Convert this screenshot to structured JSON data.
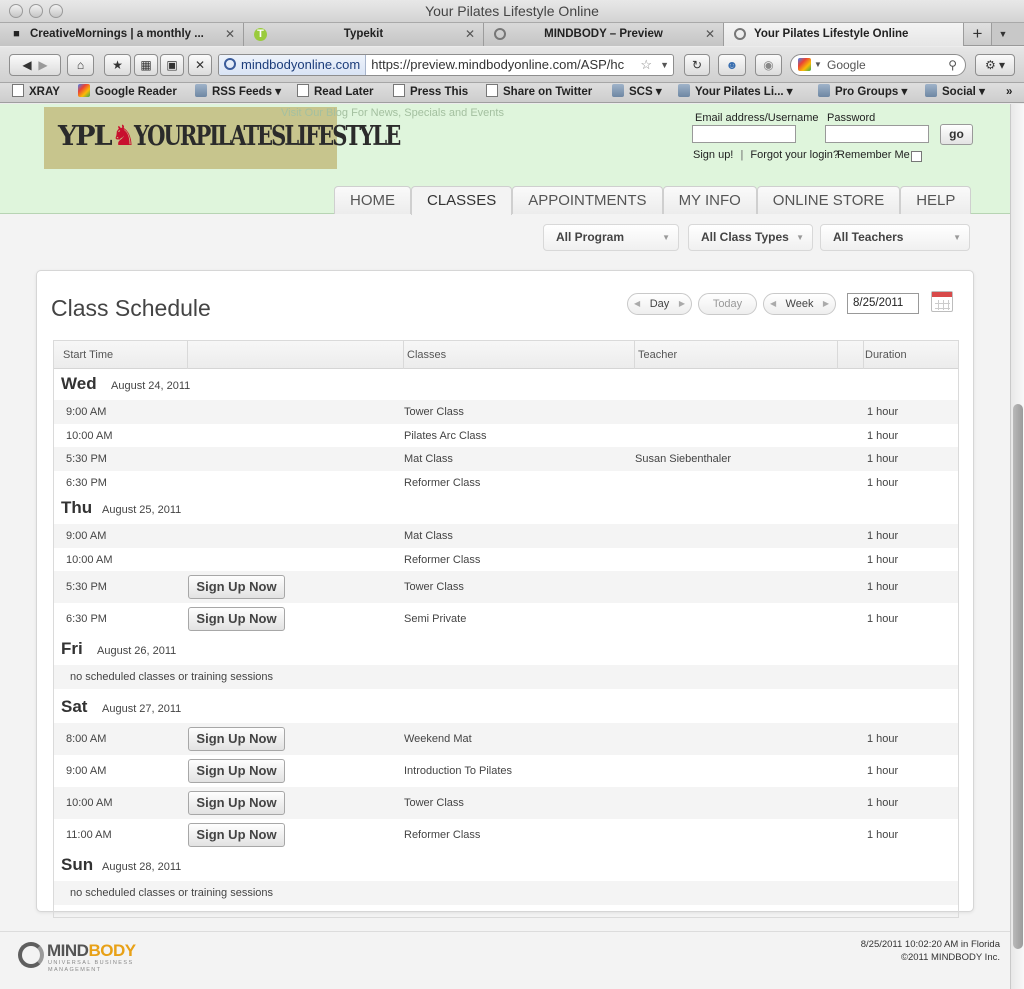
{
  "window": {
    "title": "Your Pilates Lifestyle Online"
  },
  "tabs": [
    {
      "label": "CreativeMornings | a monthly ...",
      "icon": "speech-bubble-icon"
    },
    {
      "label": "Typekit",
      "icon": "typekit-icon"
    },
    {
      "label": "MINDBODY – Preview",
      "icon": "loading-icon"
    },
    {
      "label": "Your Pilates Lifestyle Online",
      "icon": "loading-icon"
    }
  ],
  "toolbar": {
    "url_site": "mindbodyonline.com",
    "url_path": "https://preview.mindbodyonline.com/ASP/hc",
    "search_placeholder": "Google"
  },
  "bookmarks": [
    {
      "label": "XRAY",
      "icon": "page"
    },
    {
      "label": "Google Reader",
      "icon": "goog"
    },
    {
      "label": "RSS Feeds ▾",
      "icon": "folder"
    },
    {
      "label": "Read Later",
      "icon": "page"
    },
    {
      "label": "Press This",
      "icon": "page"
    },
    {
      "label": "Share on Twitter",
      "icon": "page"
    },
    {
      "label": "SCS ▾",
      "icon": "folder"
    },
    {
      "label": "Your Pilates Li... ▾",
      "icon": "folder"
    },
    {
      "label": "Pro Groups ▾",
      "icon": "folder"
    },
    {
      "label": "Social ▾",
      "icon": "folder"
    }
  ],
  "site": {
    "logo_ypl": "YPL",
    "logo_name": "YOURPILATESLIFESTYLE",
    "tagline": "Visit Our Blog For News, Specials and Events",
    "login": {
      "email_label": "Email address/Username",
      "password_label": "Password",
      "go_label": "go",
      "signup_link": "Sign up!",
      "divider": "|",
      "forgot_link": "Forgot your login?",
      "remember_label": "Remember Me"
    },
    "nav": [
      "HOME",
      "CLASSES",
      "APPOINTMENTS",
      "MY INFO",
      "ONLINE STORE",
      "HELP"
    ],
    "active_nav": "CLASSES",
    "filters": {
      "program": "All Program",
      "class_types": "All Class Types",
      "teachers": "All Teachers"
    }
  },
  "schedule": {
    "title": "Class Schedule",
    "nav": {
      "day": "Day",
      "today": "Today",
      "week": "Week",
      "date": "8/25/2011"
    },
    "columns": {
      "start_time": "Start Time",
      "classes": "Classes",
      "teacher": "Teacher",
      "duration": "Duration"
    },
    "signup_label": "Sign Up Now",
    "days": [
      {
        "name": "Wed",
        "date": "August 24, 2011",
        "rows": [
          {
            "time": "9:00 AM",
            "class": "Tower Class",
            "teacher": "",
            "duration": "1 hour",
            "signup": false
          },
          {
            "time": "10:00 AM",
            "class": "Pilates Arc Class",
            "teacher": "",
            "duration": "1 hour",
            "signup": false
          },
          {
            "time": "5:30 PM",
            "class": "Mat Class",
            "teacher": "Susan Siebenthaler",
            "duration": "1 hour",
            "signup": false
          },
          {
            "time": "6:30 PM",
            "class": "Reformer Class",
            "teacher": "",
            "duration": "1 hour",
            "signup": false
          }
        ]
      },
      {
        "name": "Thu",
        "date": "August 25, 2011",
        "rows": [
          {
            "time": "9:00 AM",
            "class": "Mat Class",
            "teacher": "",
            "duration": "1 hour",
            "signup": false
          },
          {
            "time": "10:00 AM",
            "class": "Reformer Class",
            "teacher": "",
            "duration": "1 hour",
            "signup": false
          },
          {
            "time": "5:30 PM",
            "class": "Tower Class",
            "teacher": "",
            "duration": "1 hour",
            "signup": true
          },
          {
            "time": "6:30 PM",
            "class": "Semi Private",
            "teacher": "",
            "duration": "1 hour",
            "signup": true
          }
        ]
      },
      {
        "name": "Fri",
        "date": "August 26, 2011",
        "empty": "no scheduled classes or training sessions",
        "rows": []
      },
      {
        "name": "Sat",
        "date": "August 27, 2011",
        "rows": [
          {
            "time": "8:00 AM",
            "class": "Weekend Mat",
            "teacher": "",
            "duration": "1 hour",
            "signup": true
          },
          {
            "time": "9:00 AM",
            "class": "Introduction To Pilates",
            "teacher": "",
            "duration": "1 hour",
            "signup": true
          },
          {
            "time": "10:00 AM",
            "class": "Tower Class",
            "teacher": "",
            "duration": "1 hour",
            "signup": true
          },
          {
            "time": "11:00 AM",
            "class": "Reformer Class",
            "teacher": "",
            "duration": "1 hour",
            "signup": true
          }
        ]
      },
      {
        "name": "Sun",
        "date": "August 28, 2011",
        "empty": "no scheduled classes or training sessions",
        "rows": []
      }
    ]
  },
  "footer": {
    "brand_mind": "MIND",
    "brand_body": "BODY",
    "brand_sub": "UNIVERSAL BUSINESS MANAGEMENT",
    "timestamp": "8/25/2011 10:02:20 AM in Florida",
    "copyright": "©2011 MINDBODY Inc."
  },
  "colors": {
    "header_bg": "#dff5dc",
    "logo_bg": "#c7c58d",
    "accent_orange": "#e8a117",
    "logo_red": "#c8102e"
  }
}
